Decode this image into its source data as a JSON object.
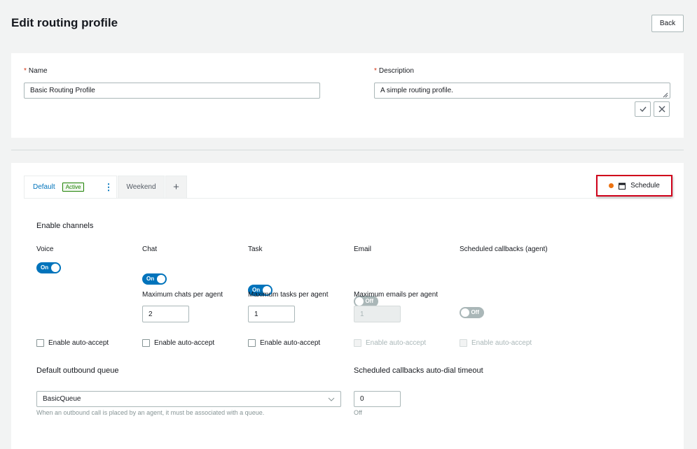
{
  "page": {
    "title": "Edit routing profile",
    "back_label": "Back"
  },
  "profile": {
    "name_label": "Name",
    "name_value": "Basic Routing Profile",
    "description_label": "Description",
    "description_value": "A simple routing profile."
  },
  "tabs": {
    "items": [
      {
        "label": "Default",
        "badge": "Active"
      },
      {
        "label": "Weekend"
      }
    ],
    "add_label": "+",
    "schedule_label": "Schedule",
    "schedule_dot_color": "#ec7211"
  },
  "channels": {
    "heading": "Enable channels",
    "items": [
      {
        "label": "Voice",
        "toggle": "On",
        "enabled": true,
        "auto_accept": "Enable auto-accept"
      },
      {
        "label": "Chat",
        "toggle": "On",
        "enabled": true,
        "max_label": "Maximum chats per agent",
        "max_value": "2",
        "auto_accept": "Enable auto-accept"
      },
      {
        "label": "Task",
        "toggle": "On",
        "enabled": true,
        "max_label": "Maximum tasks per agent",
        "max_value": "1",
        "auto_accept": "Enable auto-accept"
      },
      {
        "label": "Email",
        "toggle": "Off",
        "enabled": false,
        "max_label": "Maximum emails per agent",
        "max_value": "1",
        "auto_accept": "Enable auto-accept"
      },
      {
        "label": "Scheduled callbacks (agent)",
        "toggle": "Off",
        "enabled": false,
        "auto_accept": "Enable auto-accept"
      }
    ]
  },
  "outbound": {
    "label": "Default outbound queue",
    "value": "BasicQueue",
    "help": "When an outbound call is placed by an agent, it must be associated with a queue."
  },
  "callbacks": {
    "label": "Scheduled callbacks auto-dial timeout",
    "value": "0",
    "help": "Off"
  },
  "colors": {
    "accent": "#0073bb",
    "required": "#d13212",
    "highlight": "#d0021b",
    "active_badge": "#1d8102"
  }
}
